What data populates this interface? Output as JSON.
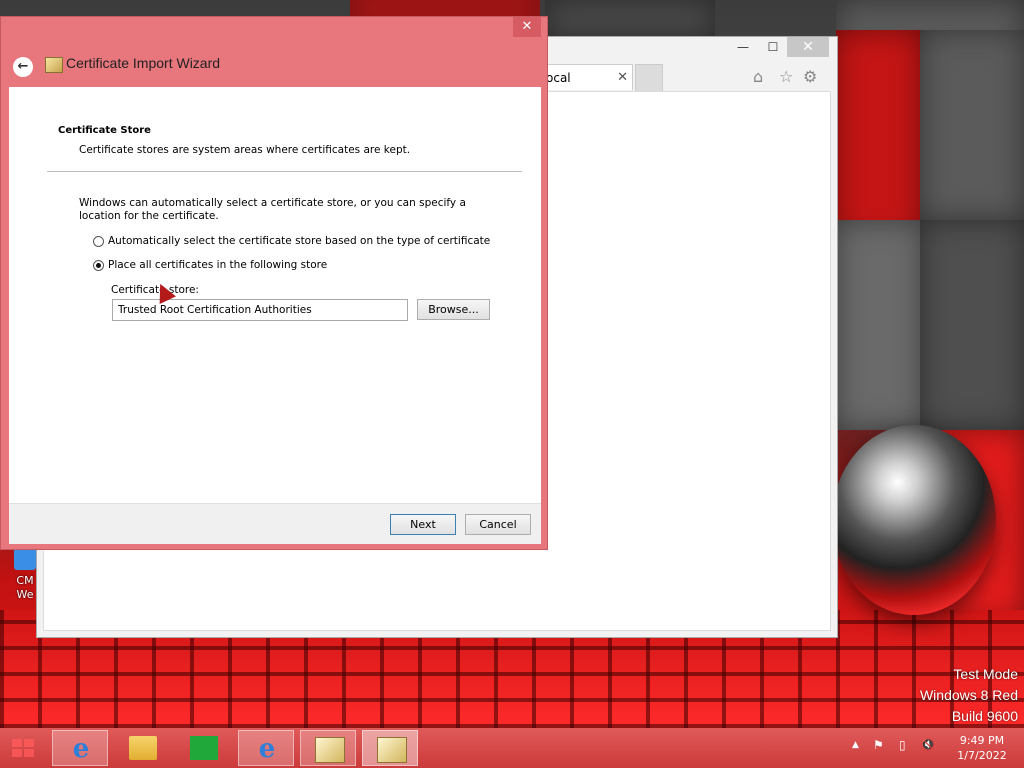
{
  "desktop": {
    "watermark": [
      "Test Mode",
      "Windows 8 Red",
      "Build 9600"
    ],
    "icon_label_1": "CM",
    "icon_label_2": "We"
  },
  "browser": {
    "tab_label": "ocal",
    "tab_close": "✕",
    "minimize": "—",
    "maximize": "☐",
    "close": "✕",
    "toolbar_icons": [
      "home-icon",
      "favorites-star-icon",
      "settings-gear-icon"
    ]
  },
  "wizard": {
    "title": "Certificate Import Wizard",
    "close_glyph": "✕",
    "back_glyph": "←",
    "section_title": "Certificate Store",
    "section_description": "Certificate stores are system areas where certificates are kept.",
    "intro": "Windows can automatically select a certificate store, or you can specify a location for the certificate.",
    "option_auto": "Automatically select the certificate store based on the type of certificate",
    "option_manual": "Place all certificates in the following store",
    "selected_option": "manual",
    "store_label": "Certificate store:",
    "store_value": "Trusted Root Certification Authorities",
    "browse_label": "Browse...",
    "next_label": "Next",
    "cancel_label": "Cancel"
  },
  "taskbar": {
    "apps": [
      "start-button",
      "internet-explorer",
      "file-explorer",
      "windows-store",
      "internet-explorer-2",
      "certificate-manager",
      "certificate-import"
    ],
    "clock_time": "9:49 PM",
    "clock_date": "1/7/2022",
    "tray_chevron": "▲",
    "tray_flag": "⚑",
    "tray_network": "▯",
    "tray_volume": "🔇"
  },
  "colors": {
    "wizard_frame": "#e8767d",
    "taskbar": "#cc3a3a",
    "desktop_red": "#e01818"
  }
}
